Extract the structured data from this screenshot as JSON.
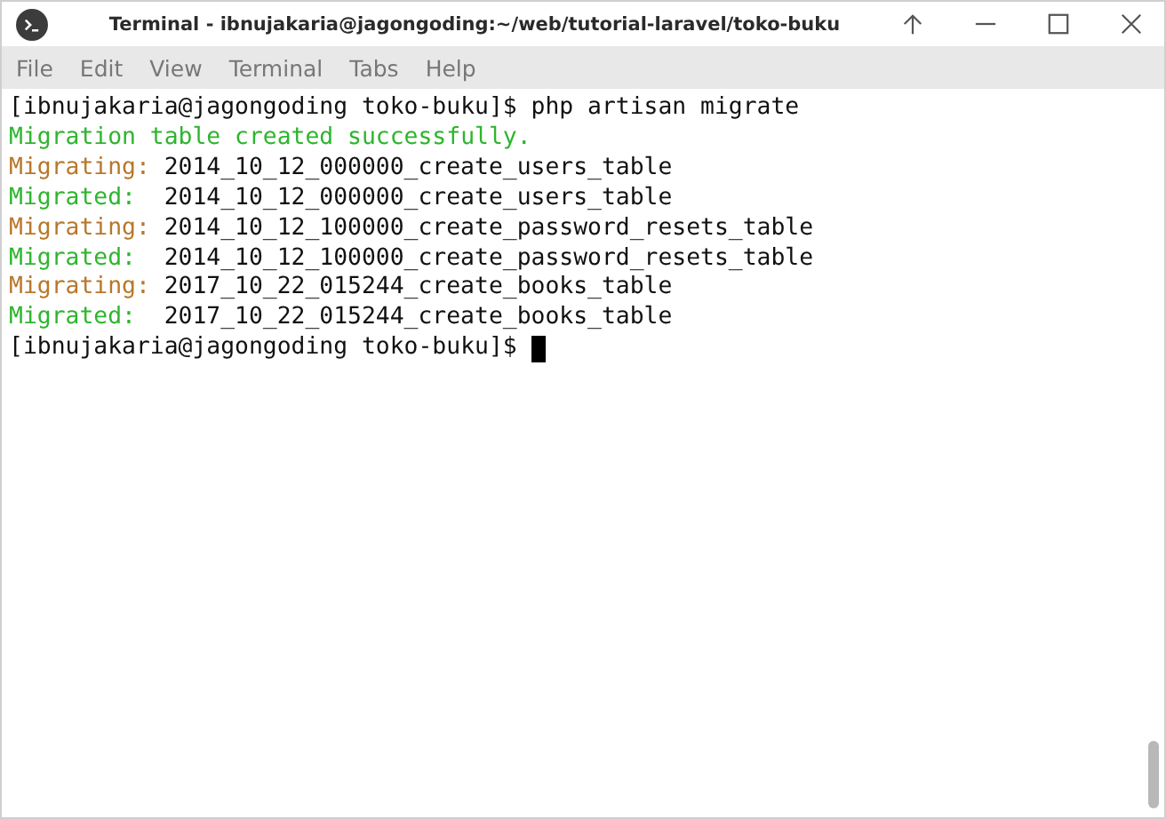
{
  "window": {
    "title": "Terminal - ibnujakaria@jagongoding:~/web/tutorial-laravel/toko-buku"
  },
  "menu": [
    "File",
    "Edit",
    "View",
    "Terminal",
    "Tabs",
    "Help"
  ],
  "lines": [
    {
      "kind": "prompt",
      "prompt": "[ibnujakaria@jagongoding toko-buku]$",
      "command": "php artisan migrate",
      "cursor": false
    },
    {
      "kind": "success",
      "text": "Migration table created successfully."
    },
    {
      "kind": "migrating",
      "label": "Migrating:",
      "text": "2014_10_12_000000_create_users_table"
    },
    {
      "kind": "migrated",
      "label": "Migrated:",
      "text": "2014_10_12_000000_create_users_table"
    },
    {
      "kind": "migrating",
      "label": "Migrating:",
      "text": "2014_10_12_100000_create_password_resets_table"
    },
    {
      "kind": "migrated",
      "label": "Migrated:",
      "text": "2014_10_12_100000_create_password_resets_table"
    },
    {
      "kind": "migrating",
      "label": "Migrating:",
      "text": "2017_10_22_015244_create_books_table"
    },
    {
      "kind": "migrated",
      "label": "Migrated:",
      "text": "2017_10_22_015244_create_books_table"
    },
    {
      "kind": "prompt",
      "prompt": "[ibnujakaria@jagongoding toko-buku]$",
      "cursor": true
    }
  ]
}
